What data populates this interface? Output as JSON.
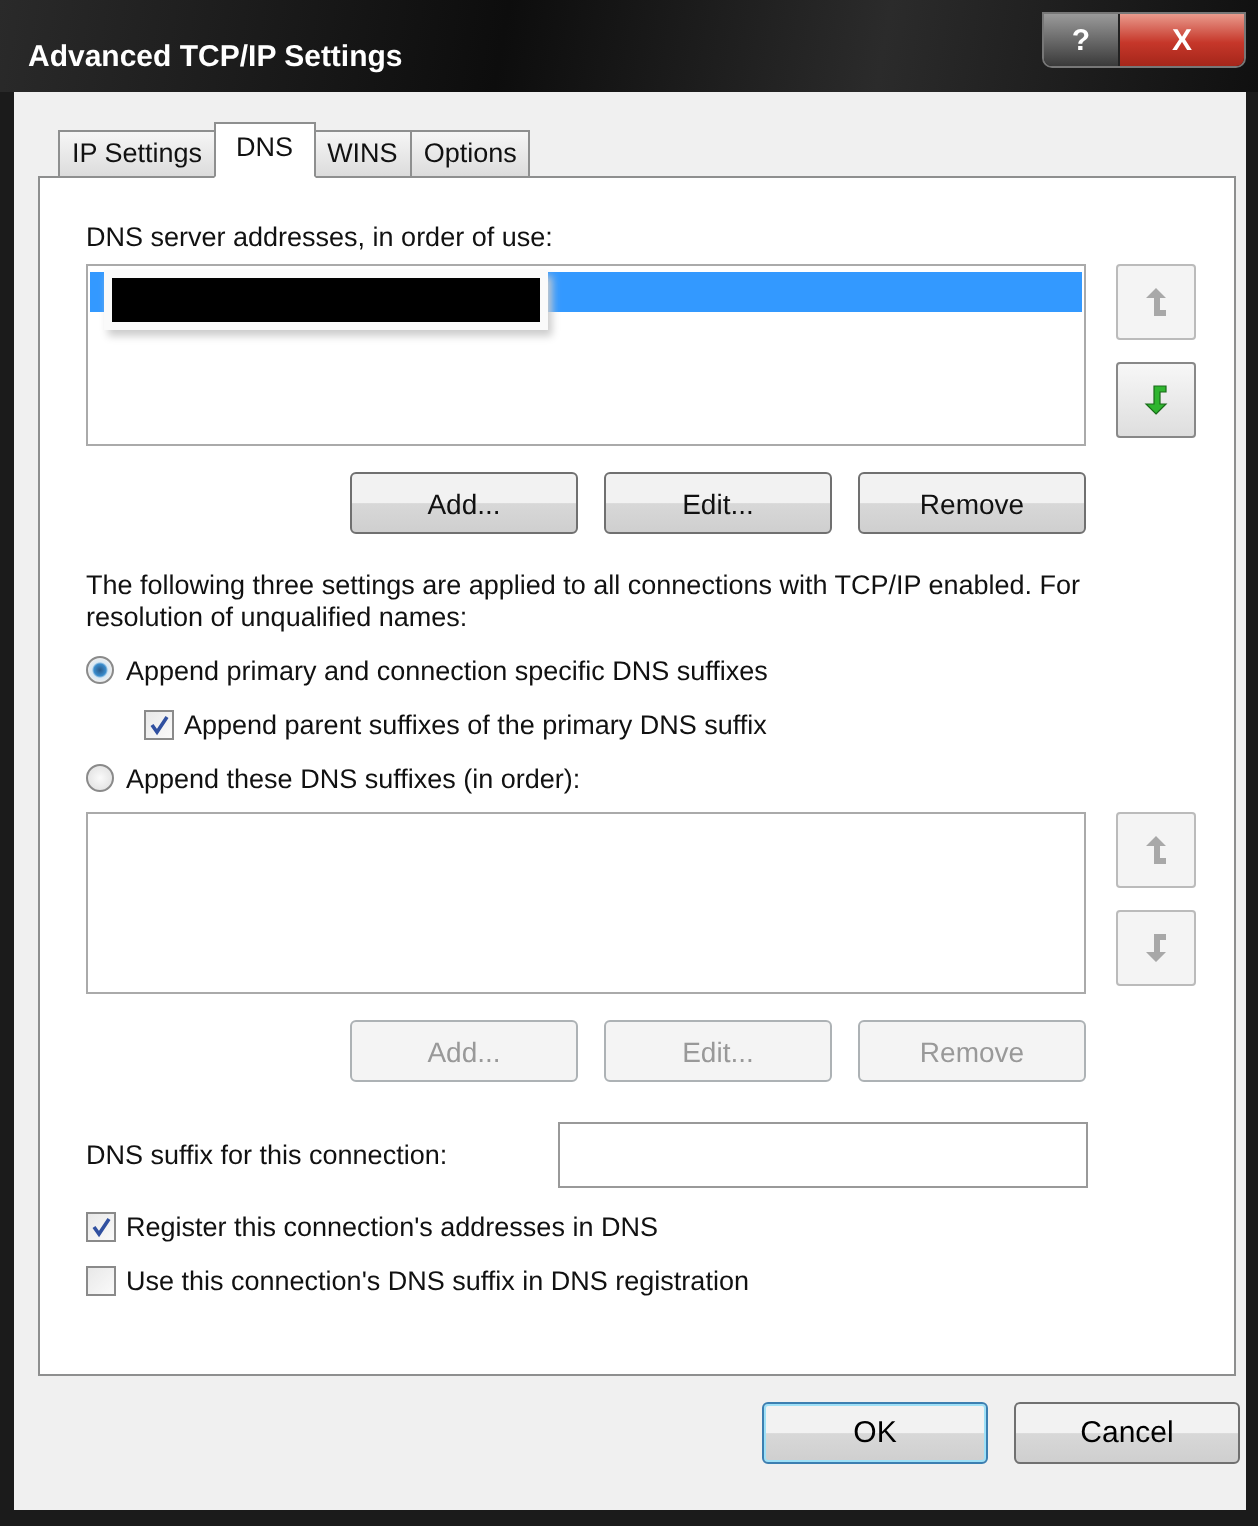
{
  "window": {
    "title": "Advanced TCP/IP Settings",
    "controls": [
      {
        "kind": "help",
        "label": "?"
      },
      {
        "kind": "close",
        "label": "X"
      }
    ]
  },
  "tabs": [
    {
      "label": "IP Settings",
      "selected": false
    },
    {
      "label": "DNS",
      "selected": true
    },
    {
      "label": "WINS",
      "selected": false
    },
    {
      "label": "Options",
      "selected": false
    }
  ],
  "dns_servers": {
    "label": "DNS server addresses, in order of use:",
    "items": [
      {
        "selected": true,
        "redacted": true
      }
    ],
    "buttons": [
      {
        "label": "Add...",
        "disabled": false
      },
      {
        "label": "Edit...",
        "disabled": false
      },
      {
        "label": "Remove",
        "disabled": false
      }
    ],
    "move": [
      {
        "kind": "up",
        "disabled": true
      },
      {
        "kind": "down",
        "disabled": false
      }
    ]
  },
  "note": "The following three settings are applied to all connections with TCP/IP enabled. For resolution of unqualified names:",
  "options": [
    {
      "kind": "radio",
      "label": "Append primary and connection specific DNS suffixes",
      "selected": true
    },
    {
      "kind": "checkbox",
      "label": "Append parent suffixes of the primary DNS suffix",
      "checked": true
    },
    {
      "kind": "radio",
      "label": "Append these DNS suffixes (in order):",
      "selected": false
    }
  ],
  "suffixes": {
    "buttons": [
      {
        "label": "Add...",
        "disabled": true
      },
      {
        "label": "Edit...",
        "disabled": true
      },
      {
        "label": "Remove",
        "disabled": true
      }
    ],
    "move": [
      {
        "kind": "up",
        "disabled": true
      },
      {
        "kind": "down",
        "disabled": true
      }
    ]
  },
  "connection_suffix": {
    "label": "DNS suffix for this connection:"
  },
  "checkboxes": [
    {
      "label": "Register this connection's addresses in DNS",
      "checked": true
    },
    {
      "label": "Use this connection's DNS suffix in DNS registration",
      "checked": false
    }
  ],
  "footer_buttons": [
    {
      "label": "OK",
      "default": true
    },
    {
      "label": "Cancel",
      "default": false
    }
  ]
}
